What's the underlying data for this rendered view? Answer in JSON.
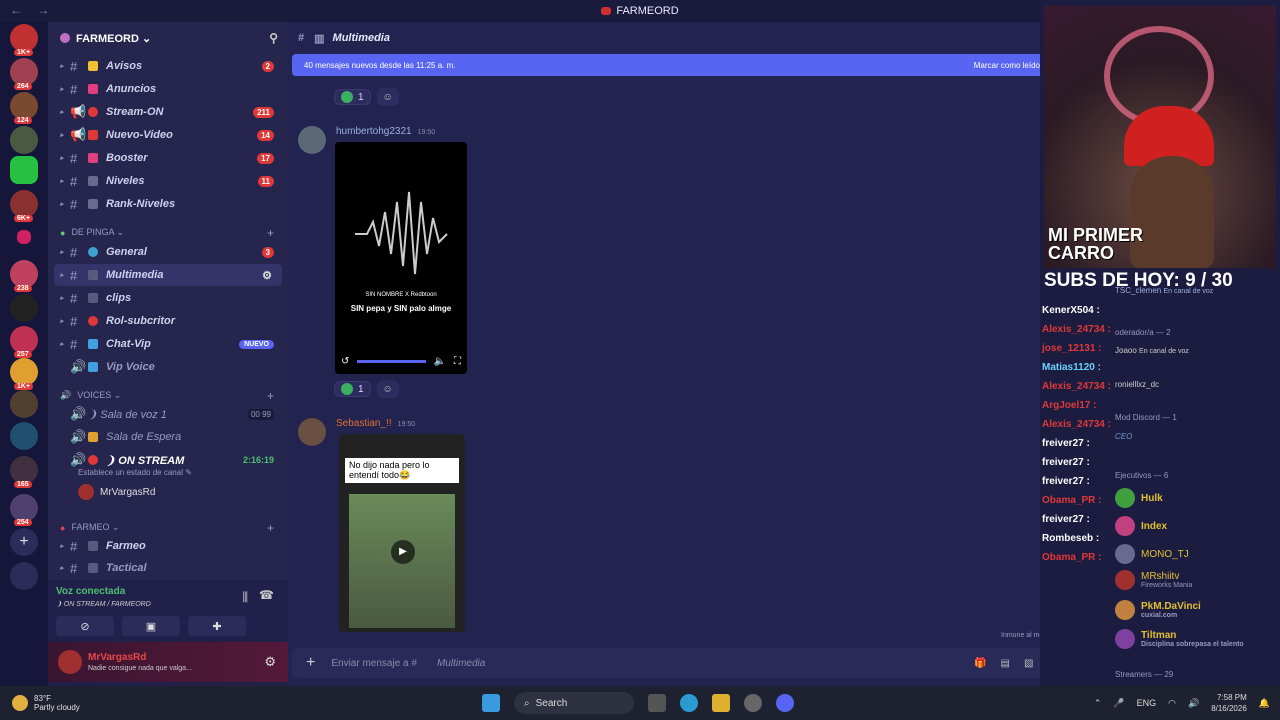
{
  "window": {
    "title": "FARMEORD",
    "nav": "← →"
  },
  "server_list": {
    "badges": [
      "1K+",
      "264",
      "124",
      "6K+",
      "238",
      "257",
      "1K+",
      "165",
      "254"
    ]
  },
  "guild": {
    "name": "FARMEORD ⌄"
  },
  "channels": [
    {
      "name": "Avisos",
      "count": "2"
    },
    {
      "name": "Anuncios",
      "count": ""
    },
    {
      "name": "Stream-ON",
      "count": "211"
    },
    {
      "name": "Nuevo-Video",
      "count": "14"
    },
    {
      "name": "Booster",
      "count": "17"
    },
    {
      "name": "Niveles",
      "count": "11"
    },
    {
      "name": "Rank-Niveles",
      "count": ""
    }
  ],
  "cat_de_pinga": "DE PINGA ⌄",
  "channels2": [
    {
      "name": "General",
      "count": "3"
    },
    {
      "name": "Multimedia",
      "count": ""
    },
    {
      "name": "clips",
      "count": ""
    },
    {
      "name": "Rol-subcritor",
      "count": ""
    },
    {
      "name": "Chat-Vip",
      "badge": "NUEVO"
    },
    {
      "name": "Vip Voice",
      "count": ""
    }
  ],
  "cat_voices": "VOICES ⌄",
  "voice": [
    {
      "name": "❩ Sala de voz 1",
      "extra": "00 99"
    },
    {
      "name": "Sala de Espera",
      "extra": ""
    },
    {
      "name": "❩ ON STREAM",
      "extra": "2:16:19"
    }
  ],
  "voice_status": "Establece un estado de canal ✎",
  "voice_user": "MrVargasRd",
  "cat_farmeo": "FARMEO ⌄",
  "channels3": [
    {
      "name": "Farmeo"
    },
    {
      "name": "Tactical"
    }
  ],
  "voice_panel": {
    "title": "Voz conectada",
    "sub": "❩ ON STREAM / FARMEORD"
  },
  "user": {
    "name": "MrVargasRd",
    "status": "Nadie consigue nada que valga..."
  },
  "header": {
    "channel": "Multimedia"
  },
  "banner": {
    "text": "40 mensajes nuevos desde las 11:25 a. m.",
    "action": "Marcar como leído"
  },
  "messages": [
    {
      "author": "humbertohg2321",
      "time": "19:50",
      "video_text1": "SIN NOMBRE X Redbtoon",
      "video_text2": "SIN pepa y SIN palo almge"
    },
    {
      "author": "Sebastian_!!",
      "time": "19:50",
      "caption": "No dijo nada pero lo entendí todo😂"
    }
  ],
  "reactions": {
    "count": "1"
  },
  "paused": "Inmune al modo pausado",
  "input": {
    "placeholder": "Enviar mensaje a #",
    "channel": "Multimedia"
  },
  "stream": {
    "overlay": "MI PRIMER CARRO",
    "subs": "SUBS DE HOY: 9 / 30"
  },
  "chat": [
    {
      "name": "KenerX504 :",
      "color": "#ffffff"
    },
    {
      "name": "Alexis_24734 :",
      "color": "#e03838"
    },
    {
      "name": "jose_12131 :",
      "color": "#e03838"
    },
    {
      "name": "Matias1120 :",
      "color": "#6ad0ff"
    },
    {
      "name": "Alexis_24734 :",
      "color": "#e03838"
    },
    {
      "name": "ArgJoel17 :",
      "color": "#e03838"
    },
    {
      "name": "Alexis_24734 :",
      "color": "#e03838"
    },
    {
      "name": "freiver27 :",
      "color": "#ffffff"
    },
    {
      "name": "freiver27 :",
      "color": "#ffffff"
    },
    {
      "name": "freiver27 :",
      "color": "#ffffff"
    },
    {
      "name": "Obama_PR :",
      "color": "#e03838"
    },
    {
      "name": "freiver27 :",
      "color": "#ffffff"
    },
    {
      "name": "Rombeseb :",
      "color": "#ffffff"
    },
    {
      "name": "Obama_PR :",
      "color": "#e03838"
    }
  ],
  "members": [
    {
      "name": "TSC_clemen",
      "sub": "En canal de voz"
    },
    {
      "name": "oderador/a — 2",
      "sub": ""
    },
    {
      "name": "Joaoo",
      "sub": "En canal de voz"
    },
    {
      "name": "ronielllxz_dc",
      "sub": ""
    },
    {
      "name": "Mod Discord — 1",
      "sub": ""
    },
    {
      "name": "CEO",
      "sub": ""
    },
    {
      "name": "Ejecutivos — 6",
      "sub": ""
    },
    {
      "name": "Hulk",
      "sub": ""
    },
    {
      "name": "Index",
      "sub": ""
    },
    {
      "name": "MONO_TJ",
      "sub": ""
    },
    {
      "name": "MRshiitv",
      "sub": "Fireworks Mania"
    },
    {
      "name": "PkM.DaVinci",
      "sub": "cuxial.com"
    },
    {
      "name": "Tiltman",
      "sub": "Disciplina sobrepasa el talento"
    },
    {
      "name": "Streamers — 29",
      "sub": ""
    }
  ],
  "taskbar": {
    "temp": "83°F",
    "weather": "Partly cloudy",
    "search": "Search",
    "lang": "ENG",
    "time": "7:58 PM",
    "date": "8/16/2026"
  }
}
